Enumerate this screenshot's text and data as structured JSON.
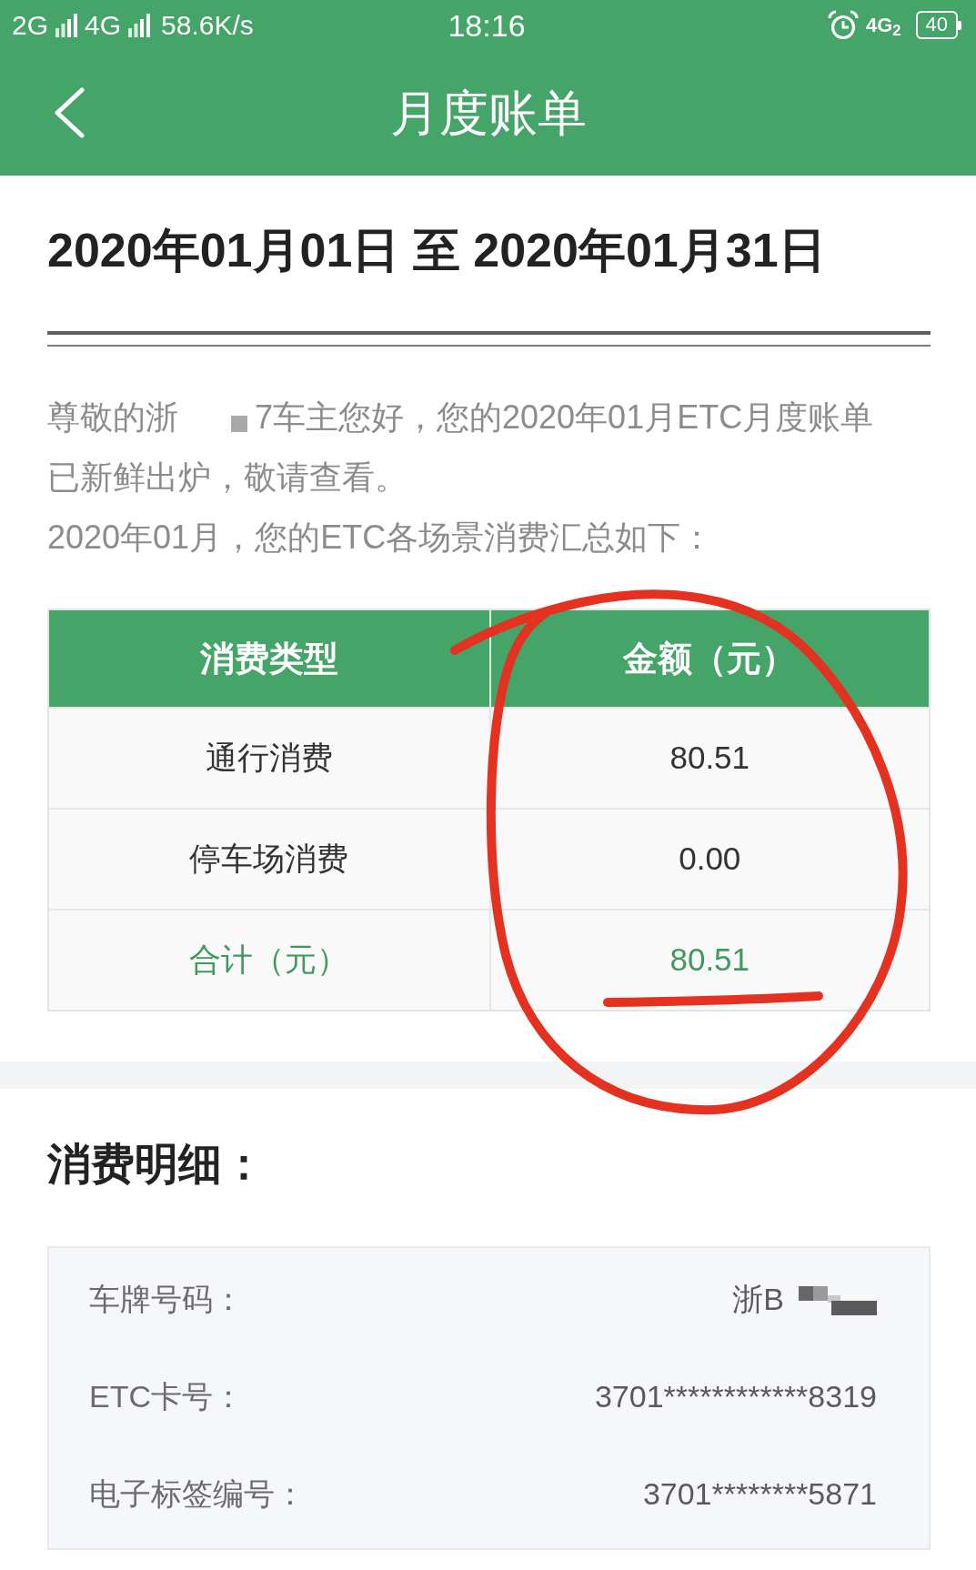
{
  "status_bar": {
    "network_1": "2G",
    "network_2": "4G",
    "speed": "58.6K/s",
    "time": "18:16",
    "network_3": "4G$_{2}$",
    "battery": "40"
  },
  "header": {
    "title": "月度账单"
  },
  "period": "2020年01月01日 至 2020年01月31日",
  "greeting": {
    "opening": "尊敬的浙",
    "redacted": true,
    "rest": "7车主您好，您的2020年01月ETC月度账单已新鲜出炉，敬请查看。"
  },
  "summary_intro": "2020年01月，您的ETC各场景消费汇总如下：",
  "summary_table": {
    "columns": [
      "消费类型",
      "金额（元）"
    ],
    "rows": [
      {
        "kind": "item",
        "cells": [
          "通行消费",
          "80.51"
        ]
      },
      {
        "kind": "item",
        "cells": [
          "停车场消费",
          "0.00"
        ]
      },
      {
        "kind": "total",
        "cells": [
          "合计（元）",
          "80.51"
        ]
      }
    ]
  },
  "details": {
    "title": "消费明细：",
    "fields": [
      {
        "label": "车牌号码：",
        "value": "浙B",
        "redacted": true
      },
      {
        "label": "ETC卡号：",
        "value": "3701************8319",
        "redacted": false
      },
      {
        "label": "电子标签编号：",
        "value": "3701********5871",
        "redacted": false
      }
    ]
  },
  "annotations": {
    "circle": true,
    "underline": true
  }
}
